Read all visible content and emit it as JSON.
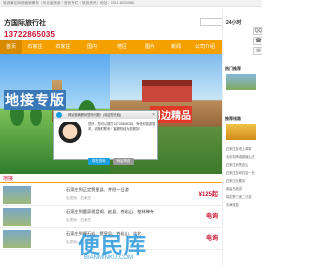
{
  "topbar": {
    "text": "旅游景区网络营销服务（河北省旅游｜首页专栏｜旅游资讯）地址：0311-6530086"
  },
  "brand": {
    "name": "方国际旅行社",
    "phone": "13722865035"
  },
  "nav": {
    "items": [
      {
        "label": "首页"
      },
      {
        "label": "石家庄"
      },
      {
        "label": "石家庄"
      },
      {
        "label": "国内"
      },
      {
        "label": "地区"
      },
      {
        "label": "图片"
      },
      {
        "label": "新闻"
      },
      {
        "label": "公司介绍"
      }
    ]
  },
  "banner": {
    "title_left": "地接专版",
    "title_right": "周边精品",
    "dots": 3
  },
  "popup": {
    "header": "网站营销顾问您好问题！(欢迎您光临)",
    "message": "您好，您可以拨打13722865035，有任何旅游需求，请随时联系！客服热线为您服务！",
    "accept": "现在咨询",
    "later": "稍后再说",
    "close": "×"
  },
  "section": {
    "title": "地接"
  },
  "rows": [
    {
      "title": "石家庄到正定赞皇县、井陉一日游",
      "meta": "出发地：石家庄",
      "price": "¥125起",
      "big": ""
    },
    {
      "title": "石家庄到鹿泉观音阁、赵县、苍岩山、柏林禅寺",
      "meta": "出发地：石家庄",
      "price": "电询",
      "big": ""
    },
    {
      "title": "石家庄到嶂石岩、赞皇县、苍岩山、古北",
      "meta": "出发地：石家庄",
      "price": "电询",
      "big": ""
    }
  ],
  "watermark": {
    "main": "便民库",
    "sub": "BIANMINKU.COM"
  },
  "sidebar": {
    "tel": "24小时",
    "contact_buttons": [
      {
        "label": "QQ"
      },
      {
        "label": "☎"
      },
      {
        "label": "✉"
      }
    ],
    "section1": "热门推荐",
    "section2": "推荐线路",
    "lines": [
      "石家庄至坝上草原",
      "北京到承德避暑山庄",
      "石家庄到苍岩山",
      "石家庄至嶂石岩一日",
      "石家庄北戴河",
      "秦皇岛旅游",
      "保定野三坡二日游",
      "天津旅游"
    ]
  }
}
